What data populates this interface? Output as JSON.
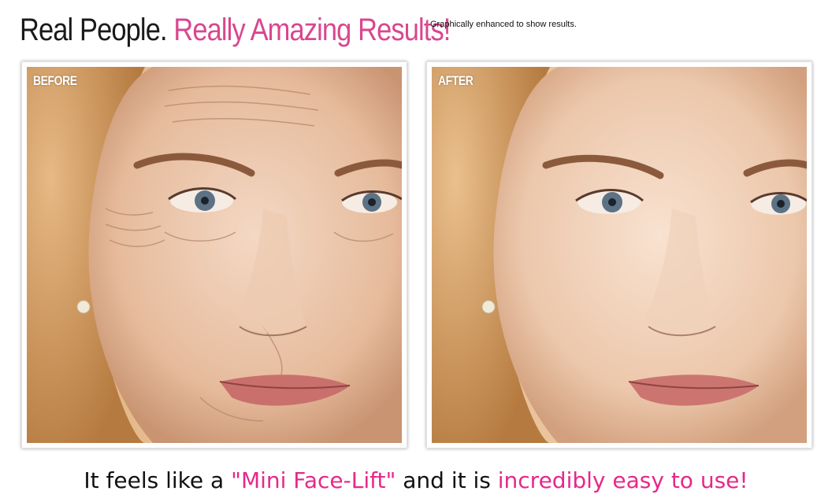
{
  "header": {
    "headline_part1": "Real People.",
    "headline_part2": "Really Amazing Results!",
    "disclaimer": "Graphically enhanced to show results."
  },
  "photos": {
    "before": {
      "label": "BEFORE"
    },
    "after": {
      "label": "AFTER"
    }
  },
  "tagline": {
    "part1": "It feels like a",
    "part2": "\"Mini Face-Lift\"",
    "part3": "and it is",
    "part4": "incredibly easy to use!"
  },
  "colors": {
    "accent_pink": "#e6288a",
    "headline_pink": "#d9478f",
    "text_dark": "#111111"
  }
}
